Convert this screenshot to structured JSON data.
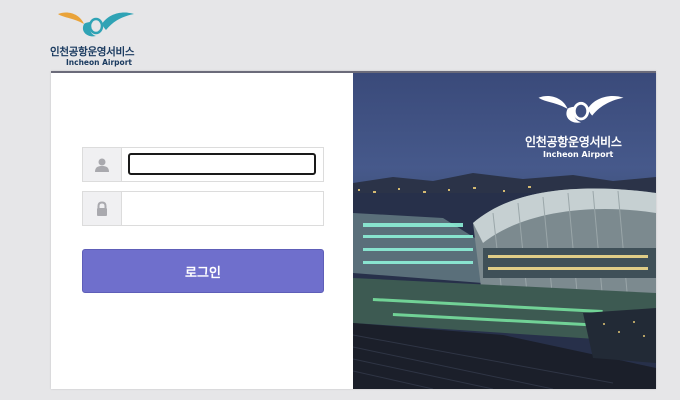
{
  "header": {
    "logo_kr": "인천공항운영서비스",
    "logo_en": "Incheon Airport",
    "logo_colors": [
      "#e9a33a",
      "#2fa3b5",
      "#1b3b60"
    ]
  },
  "login": {
    "user_icon": "user-icon",
    "lock_icon": "lock-icon",
    "username_value": "",
    "password_value": "",
    "button_label": "로그인",
    "button_color": "#6f6fcc"
  },
  "banner": {
    "logo_kr": "인천공항운영서비스",
    "logo_en": "Incheon Airport",
    "image_subject": "incheon-airport-terminal-night-photo"
  }
}
